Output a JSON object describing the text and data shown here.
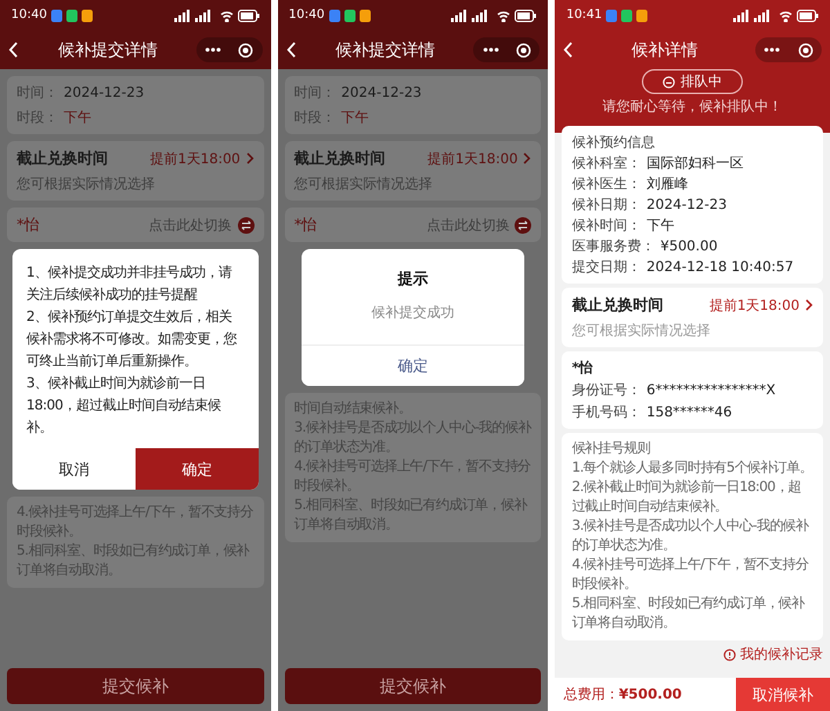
{
  "screens": [
    {
      "kind": "form",
      "dimmed": true,
      "status": {
        "time": "10:40"
      },
      "title": "候补提交详情",
      "visit": [
        {
          "label": "时间：",
          "value": "2024-12-23",
          "highlight": false
        },
        {
          "label": "时段：",
          "value": "下午",
          "highlight": true
        }
      ],
      "deadline": {
        "title": "截止兑换时间",
        "value": "提前1天18:00",
        "hint": "您可根据实际情况选择"
      },
      "patient": {
        "name": "*怡",
        "switch_hint": "点击此处切换"
      },
      "dialog": {
        "kind": "confirm",
        "paragraphs": [
          "1、候补提交成功并非挂号成功，请关注后续候补成功的挂号提醒",
          "2、候补预约订单提交生效后，相关候补需求将不可修改。如需变更，您可终止当前订单后重新操作。",
          "3、候补截止时间为就诊前一日18:00，超过截止时间自动结束候补。"
        ],
        "buttons": [
          {
            "label": "取消",
            "primary": false
          },
          {
            "label": "确定",
            "primary": true
          }
        ]
      },
      "rules": [
        "4.候补挂号可选择上午/下午，暂不支持分时段候补。",
        "5.相同科室、时段如已有约成订单，候补订单将自动取消。"
      ],
      "submit": "提交候补"
    },
    {
      "kind": "form",
      "dimmed": true,
      "status": {
        "time": "10:40"
      },
      "title": "候补提交详情",
      "visit": [
        {
          "label": "时间：",
          "value": "2024-12-23",
          "highlight": false
        },
        {
          "label": "时段：",
          "value": "下午",
          "highlight": true
        }
      ],
      "deadline": {
        "title": "截止兑换时间",
        "value": "提前1天18:00",
        "hint": "您可根据实际情况选择"
      },
      "patient": {
        "name": "*怡",
        "switch_hint": "点击此处切换"
      },
      "dialog": {
        "kind": "alert",
        "title": "提示",
        "message": "候补提交成功",
        "buttons": [
          {
            "label": "确定",
            "primary": false
          }
        ]
      },
      "rules": [
        "时间自动结束候补。",
        "3.候补挂号是否成功以个人中心-我的候补的订单状态为准。",
        "4.候补挂号可选择上午/下午，暂不支持分时段候补。",
        "5.相同科室、时段如已有约成订单，候补订单将自动取消。"
      ],
      "submit": "提交候补"
    },
    {
      "kind": "detail",
      "dimmed": false,
      "status": {
        "time": "10:41"
      },
      "title": "候补详情",
      "state_pill": "排队中",
      "wait_message": "请您耐心等待，候补排队中！",
      "info": {
        "title": "候补预约信息",
        "rows": [
          {
            "label": "候补科室：",
            "value": "国际部妇科一区"
          },
          {
            "label": "候补医生：",
            "value": "刘雁峰"
          },
          {
            "label": "候补日期：",
            "value": "2024-12-23"
          },
          {
            "label": "候补时间：",
            "value": "下午"
          },
          {
            "label": "医事服务费：",
            "value": "¥500.00"
          },
          {
            "label": "提交日期：",
            "value": "2024-12-18 10:40:57"
          }
        ]
      },
      "deadline": {
        "title": "截止兑换时间",
        "value": "提前1天18:00",
        "hint": "您可根据实际情况选择"
      },
      "patient": {
        "name": "*怡",
        "rows": [
          {
            "label": "身份证号：",
            "value": "6****************X"
          },
          {
            "label": "手机号码：",
            "value": "158******46"
          }
        ]
      },
      "rules_title": "候补挂号规则",
      "rules": [
        "1.每个就诊人最多同时持有5个候补订单。",
        "2.候补截止时间为就诊前一日18:00，超过截止时间自动结束候补。",
        "3.候补挂号是否成功以个人中心-我的候补的订单状态为准。",
        "4.候补挂号可选择上午/下午，暂不支持分时段候补。",
        "5.相同科室、时段如已有约成订单，候补订单将自动取消。"
      ],
      "records_link": "我的候补记录",
      "total_label": "总费用：",
      "total_value": "¥500.00",
      "cancel": "取消候补"
    }
  ]
}
